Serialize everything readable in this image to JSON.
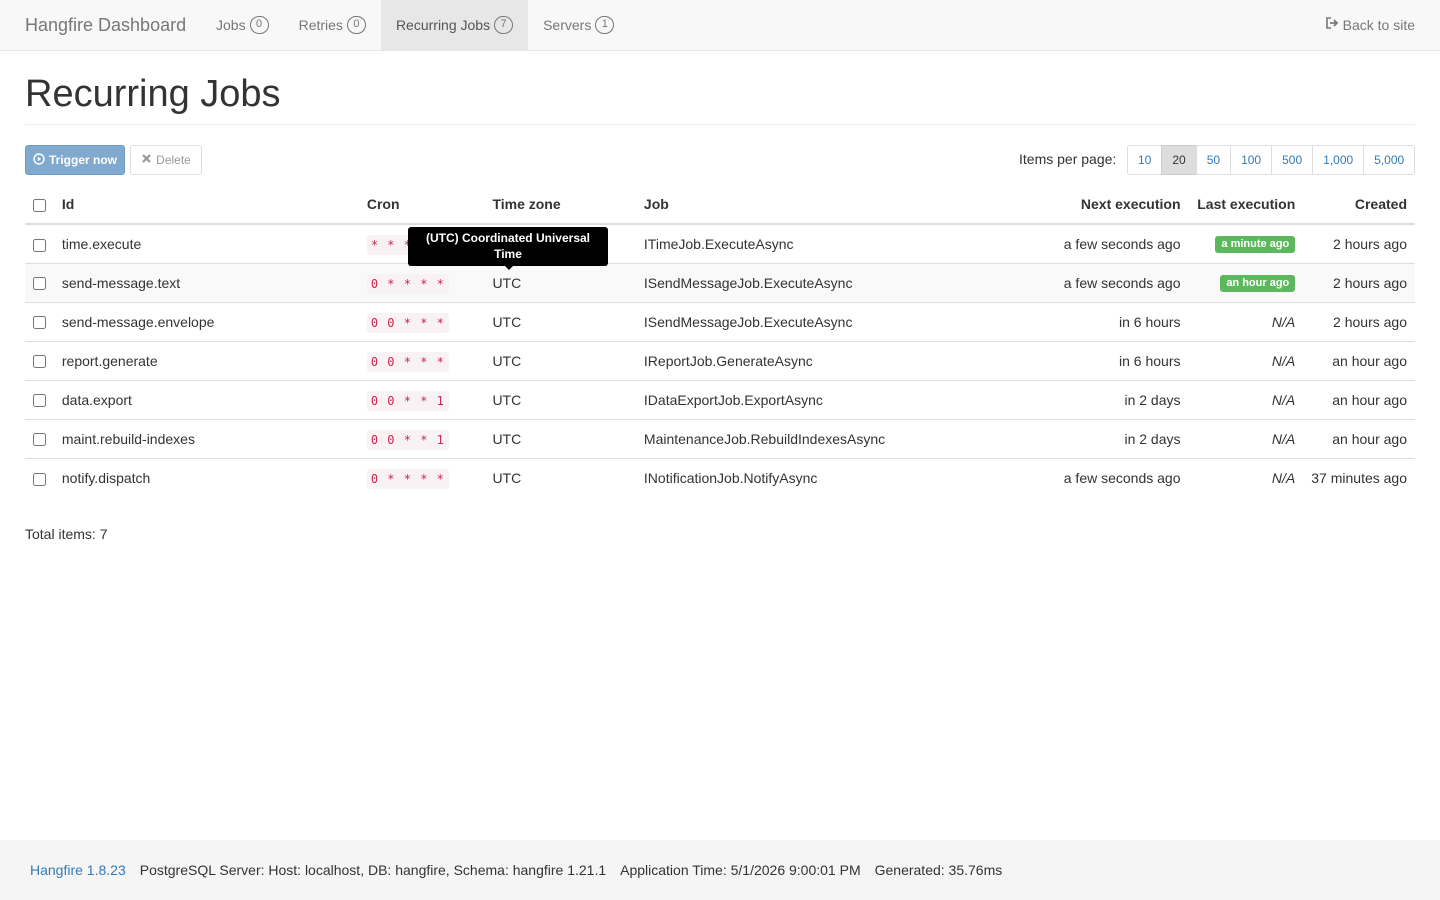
{
  "navbar": {
    "brand": "Hangfire Dashboard",
    "items": [
      {
        "label": "Jobs",
        "count": "0"
      },
      {
        "label": "Retries",
        "count": "0"
      },
      {
        "label": "Recurring Jobs",
        "count": "7"
      },
      {
        "label": "Servers",
        "count": "1"
      }
    ],
    "back_label": "Back to site"
  },
  "page": {
    "title": "Recurring Jobs"
  },
  "toolbar": {
    "trigger_label": "Trigger now",
    "delete_label": "Delete",
    "items_per_page_label": "Items per page:",
    "page_sizes": [
      "10",
      "20",
      "50",
      "100",
      "500",
      "1,000",
      "5,000"
    ],
    "selected_page_size": "20"
  },
  "table": {
    "headers": {
      "id": "Id",
      "cron": "Cron",
      "timezone": "Time zone",
      "job": "Job",
      "next": "Next execution",
      "last": "Last execution",
      "created": "Created"
    },
    "rows": [
      {
        "id": "time.execute",
        "cron": "* * * * *",
        "timezone": "UTC",
        "job": "ITimeJob.ExecuteAsync",
        "next": "a few seconds ago",
        "last": "a minute ago",
        "created": "2 hours ago"
      },
      {
        "id": "send-message.text",
        "cron": "0 * * * *",
        "timezone": "UTC",
        "job": "ISendMessageJob.ExecuteAsync",
        "next": "a few seconds ago",
        "last": "an hour ago",
        "created": "2 hours ago"
      },
      {
        "id": "send-message.envelope",
        "cron": "0 0 * * *",
        "timezone": "UTC",
        "job": "ISendMessageJob.ExecuteAsync",
        "next": "in 6 hours",
        "last": "N/A",
        "created": "2 hours ago"
      },
      {
        "id": "report.generate",
        "cron": "0 0 * * *",
        "timezone": "UTC",
        "job": "IReportJob.GenerateAsync",
        "next": "in 6 hours",
        "last": "N/A",
        "created": "an hour ago"
      },
      {
        "id": "data.export",
        "cron": "0 0 * * 1",
        "timezone": "UTC",
        "job": "IDataExportJob.ExportAsync",
        "next": "in 2 days",
        "last": "N/A",
        "created": "an hour ago"
      },
      {
        "id": "maint.rebuild-indexes",
        "cron": "0 0 * * 1",
        "timezone": "UTC",
        "job": "MaintenanceJob.RebuildIndexesAsync",
        "next": "in 2 days",
        "last": "N/A",
        "created": "an hour ago"
      },
      {
        "id": "notify.dispatch",
        "cron": "0 * * * *",
        "timezone": "UTC",
        "job": "INotificationJob.NotifyAsync",
        "next": "a few seconds ago",
        "last": "N/A",
        "created": "37 minutes ago"
      }
    ]
  },
  "tooltip": {
    "text": "(UTC) Coordinated Universal Time"
  },
  "total_items": "Total items: 7",
  "footer": {
    "version": "Hangfire 1.8.23",
    "storage": "PostgreSQL Server: Host: localhost, DB: hangfire, Schema: hangfire 1.21.1",
    "app_time": "Application Time: 5/1/2026 9:00:01 PM",
    "generated": "Generated: 35.76ms"
  },
  "colors": {
    "primary": "#337ab7",
    "success": "#5cb85c",
    "cron_text": "#c7254e"
  }
}
